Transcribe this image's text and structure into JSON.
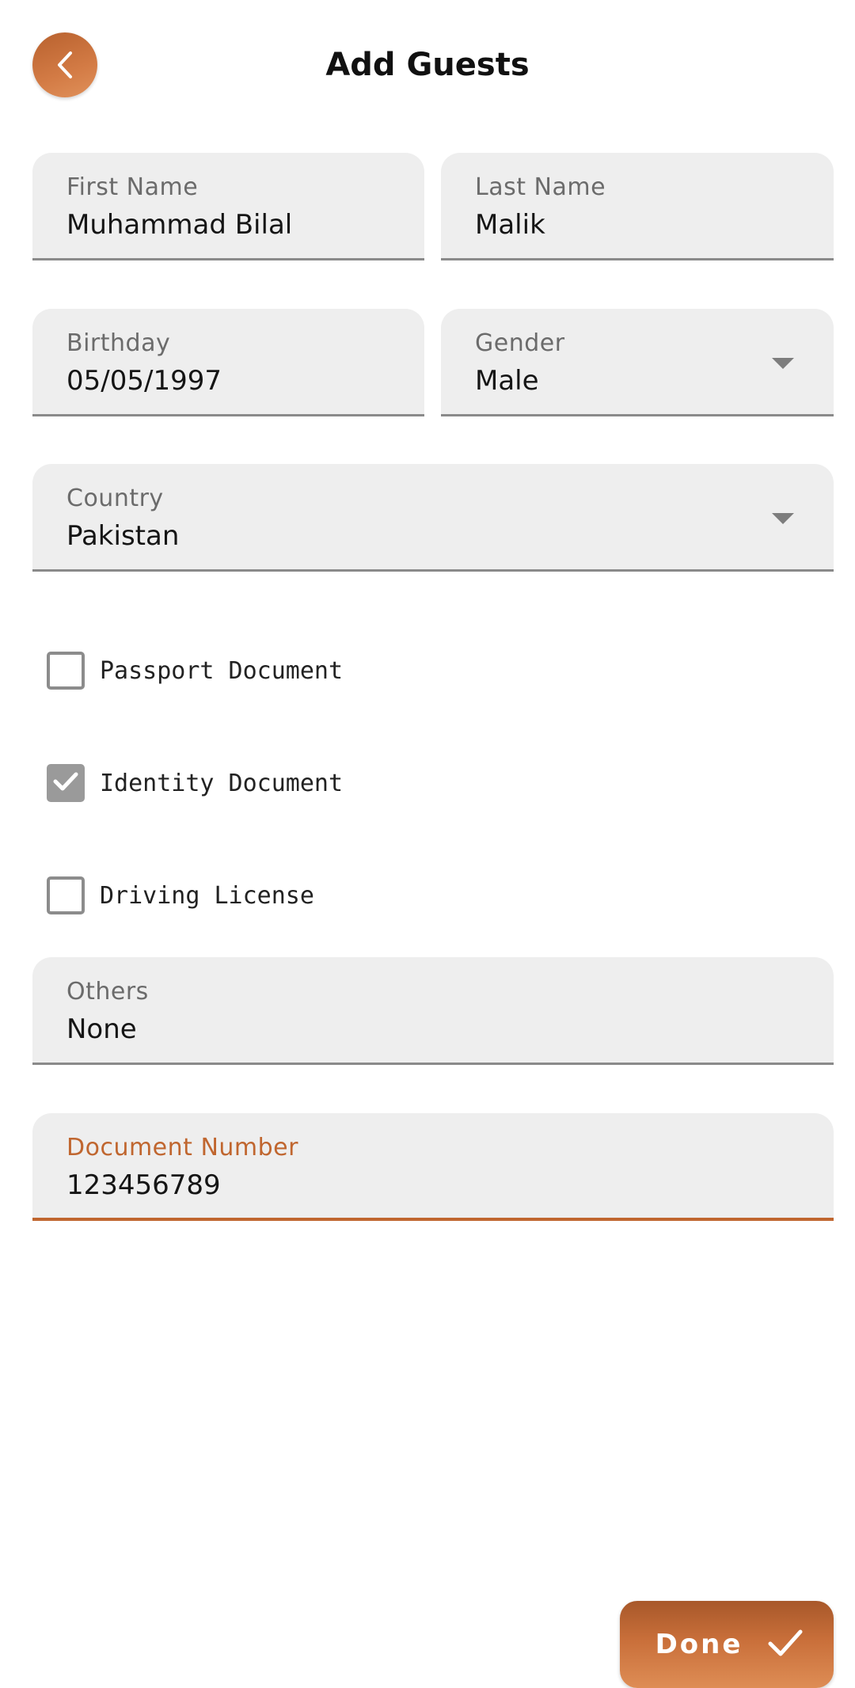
{
  "header": {
    "title": "Add Guests",
    "back_icon": "chevron-left-icon"
  },
  "form": {
    "first_name": {
      "label": "First Name",
      "value": "Muhammad Bilal"
    },
    "last_name": {
      "label": "Last Name",
      "value": "Malik"
    },
    "birthday": {
      "label": "Birthday",
      "value": "05/05/1997"
    },
    "gender": {
      "label": "Gender",
      "value": "Male"
    },
    "country": {
      "label": "Country",
      "value": "Pakistan"
    },
    "documents": [
      {
        "label": "Passport Document",
        "checked": false
      },
      {
        "label": "Identity Document",
        "checked": true
      },
      {
        "label": "Driving License",
        "checked": false
      }
    ],
    "others": {
      "label": "Others",
      "value": "None"
    },
    "document_number": {
      "label": "Document Number",
      "value": "123456789"
    }
  },
  "actions": {
    "done_label": "Done",
    "done_icon": "checkmark-icon"
  },
  "colors": {
    "accent": "#c0662f",
    "field_background": "#eeeeee",
    "checkbox_checked": "#9a9a9a"
  }
}
